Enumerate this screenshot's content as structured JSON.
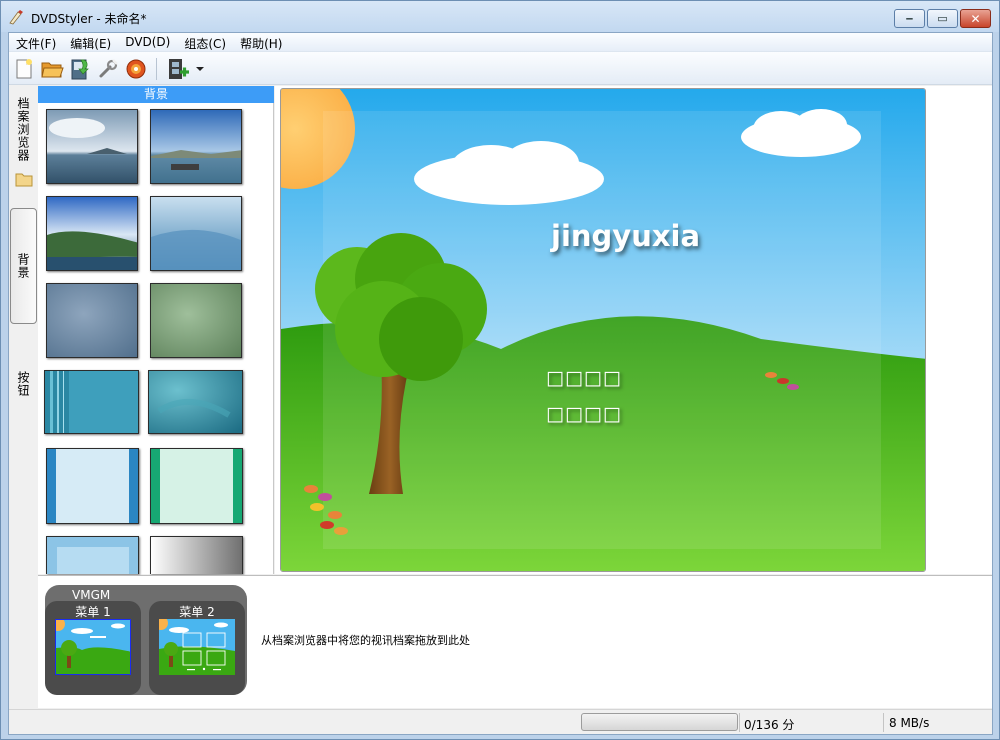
{
  "window": {
    "title": "DVDStyler - 未命名*"
  },
  "menubar": [
    "文件(F)",
    "编辑(E)",
    "DVD(D)",
    "组态(C)",
    "帮助(H)"
  ],
  "toolbar": {
    "icons": [
      "new-file-icon",
      "open-folder-icon",
      "save-icon",
      "settings-wrench-icon",
      "burn-disc-icon",
      "add-video-icon",
      "dropdown-arrow-icon"
    ]
  },
  "vtabs": [
    "档案浏览器",
    "背景",
    "按钮"
  ],
  "panel": {
    "header": "背景",
    "scroll_fraction_top": 0.0
  },
  "canvas": {
    "title": "jingyuxia",
    "buttons": [
      "□□□□",
      "□□□□"
    ]
  },
  "titleset": {
    "vmgm_label": "VMGM",
    "menus": [
      "菜单 1",
      "菜单 2"
    ],
    "drop_hint": "从档案浏览器中将您的视讯档案拖放到此处"
  },
  "status": {
    "progress_fraction": 0.0,
    "size_text": "0/136 分",
    "rate_text": "8 MB/s"
  }
}
